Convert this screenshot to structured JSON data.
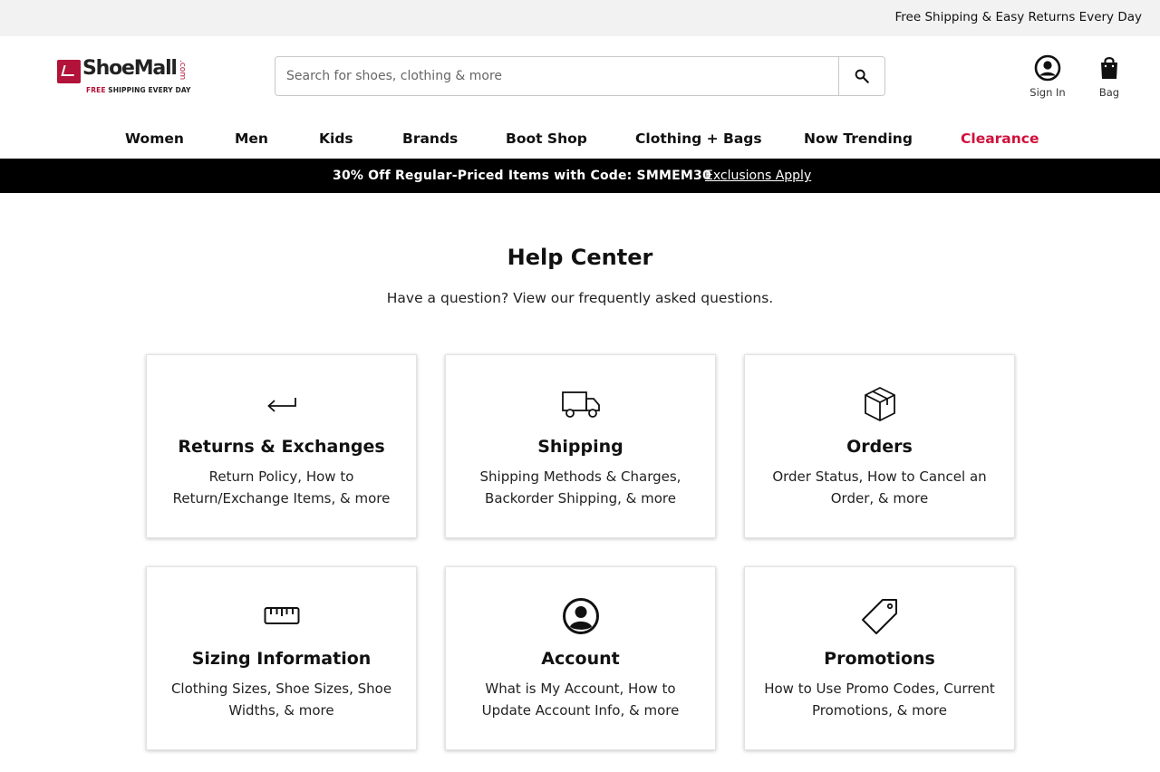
{
  "topbar": {
    "promo": "Free Shipping & Easy Returns Every Day"
  },
  "logo": {
    "brand": "ShoeMall",
    "dotcom": ".com",
    "tag_free": "FREE",
    "tag_rest": " SHIPPING EVERY DAY"
  },
  "search": {
    "placeholder": "Search for shoes, clothing & more",
    "icon": "search-icon"
  },
  "account": {
    "sign_in": "Sign In",
    "bag": "Bag"
  },
  "nav": [
    {
      "label": "Women"
    },
    {
      "label": "Men"
    },
    {
      "label": "Kids"
    },
    {
      "label": "Brands"
    },
    {
      "label": "Boot Shop"
    },
    {
      "label": "Clothing + Bags"
    },
    {
      "label": "Now Trending"
    },
    {
      "label": "Clearance",
      "color": "#d0103a"
    }
  ],
  "banner": {
    "code_text": "30% Off Regular-Priced Items with Code: SMMEM30",
    "exclusions": "Exclusions Apply"
  },
  "help": {
    "title": "Help Center",
    "subtitle": "Have a question? View our frequently asked questions."
  },
  "cards": [
    {
      "icon": "return-arrow-icon",
      "title": "Returns & Exchanges",
      "desc": "Return Policy, How to Return/Exchange Items, & more"
    },
    {
      "icon": "truck-icon",
      "title": "Shipping",
      "desc": "Shipping Methods & Charges, Backorder Shipping, & more"
    },
    {
      "icon": "box-icon",
      "title": "Orders",
      "desc": "Order Status, How to Cancel an Order, & more"
    },
    {
      "icon": "ruler-icon",
      "title": "Sizing Information",
      "desc": "Clothing Sizes, Shoe Sizes, Shoe Widths, & more"
    },
    {
      "icon": "user-circle-icon",
      "title": "Account",
      "desc": "What is My Account, How to Update Account Info, & more"
    },
    {
      "icon": "tag-icon",
      "title": "Promotions",
      "desc": "How to Use Promo Codes, Current Promotions, & more"
    }
  ],
  "colors": {
    "brand": "#b3123a",
    "clearance": "#d0103a",
    "banner_bg": "#000000"
  }
}
